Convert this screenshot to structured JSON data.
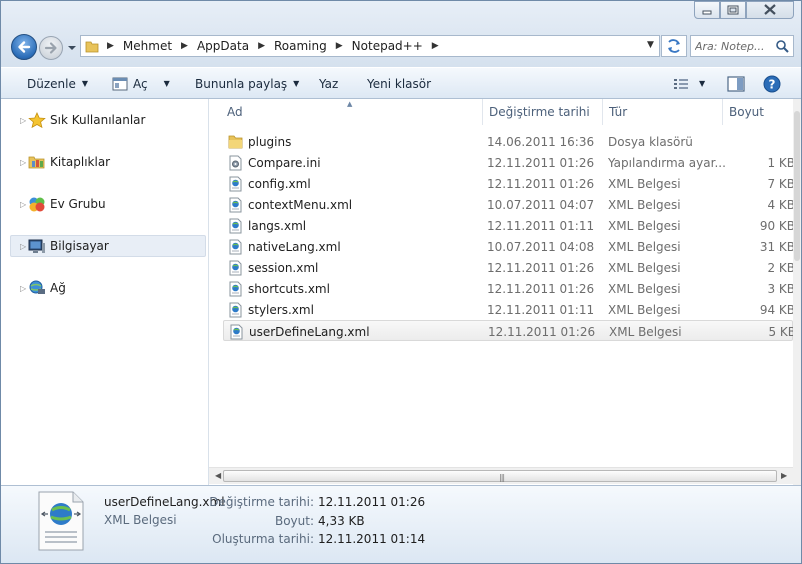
{
  "breadcrumb": [
    "Mehmet",
    "AppData",
    "Roaming",
    "Notepad++"
  ],
  "search": {
    "placeholder": "Ara: Notep..."
  },
  "toolbar": {
    "organize": "Düzenle",
    "open": "Aç",
    "share": "Bununla paylaş",
    "print": "Yaz",
    "new_folder": "Yeni klasör"
  },
  "nav": [
    {
      "label": "Sık Kullanılanlar",
      "icon": "star-icon"
    },
    {
      "label": "Kitaplıklar",
      "icon": "libraries-icon"
    },
    {
      "label": "Ev Grubu",
      "icon": "homegroup-icon"
    },
    {
      "label": "Bilgisayar",
      "icon": "computer-icon",
      "selected": true
    },
    {
      "label": "Ağ",
      "icon": "network-icon"
    }
  ],
  "columns": {
    "name": "Ad",
    "date": "Değiştirme tarihi",
    "type": "Tür",
    "size": "Boyut"
  },
  "files": [
    {
      "name": "plugins",
      "date": "14.06.2011 16:36",
      "type": "Dosya klasörü",
      "size": "",
      "icon": "folder-icon"
    },
    {
      "name": "Compare.ini",
      "date": "12.11.2011 01:26",
      "type": "Yapılandırma ayar...",
      "size": "1 KB",
      "icon": "settings-file-icon"
    },
    {
      "name": "config.xml",
      "date": "12.11.2011 01:26",
      "type": "XML Belgesi",
      "size": "7 KB",
      "icon": "xml-file-icon"
    },
    {
      "name": "contextMenu.xml",
      "date": "10.07.2011 04:07",
      "type": "XML Belgesi",
      "size": "4 KB",
      "icon": "xml-file-icon"
    },
    {
      "name": "langs.xml",
      "date": "12.11.2011 01:11",
      "type": "XML Belgesi",
      "size": "90 KB",
      "icon": "xml-file-icon"
    },
    {
      "name": "nativeLang.xml",
      "date": "10.07.2011 04:08",
      "type": "XML Belgesi",
      "size": "31 KB",
      "icon": "xml-file-icon"
    },
    {
      "name": "session.xml",
      "date": "12.11.2011 01:26",
      "type": "XML Belgesi",
      "size": "2 KB",
      "icon": "xml-file-icon"
    },
    {
      "name": "shortcuts.xml",
      "date": "12.11.2011 01:26",
      "type": "XML Belgesi",
      "size": "3 KB",
      "icon": "xml-file-icon"
    },
    {
      "name": "stylers.xml",
      "date": "12.11.2011 01:11",
      "type": "XML Belgesi",
      "size": "94 KB",
      "icon": "xml-file-icon"
    },
    {
      "name": "userDefineLang.xml",
      "date": "12.11.2011 01:26",
      "type": "XML Belgesi",
      "size": "5 KB",
      "icon": "xml-file-icon",
      "selected": true
    }
  ],
  "details": {
    "name": "userDefineLang.xml",
    "type": "XML Belgesi",
    "modified_label": "Değiştirme tarihi:",
    "modified": "12.11.2011 01:26",
    "size_label": "Boyut:",
    "size": "4,33 KB",
    "created_label": "Oluşturma tarihi:",
    "created": "12.11.2011 01:14"
  },
  "colors": {
    "selection": "#e8eef6",
    "accent": "#2b6db8",
    "folder": "#e8c35a"
  }
}
